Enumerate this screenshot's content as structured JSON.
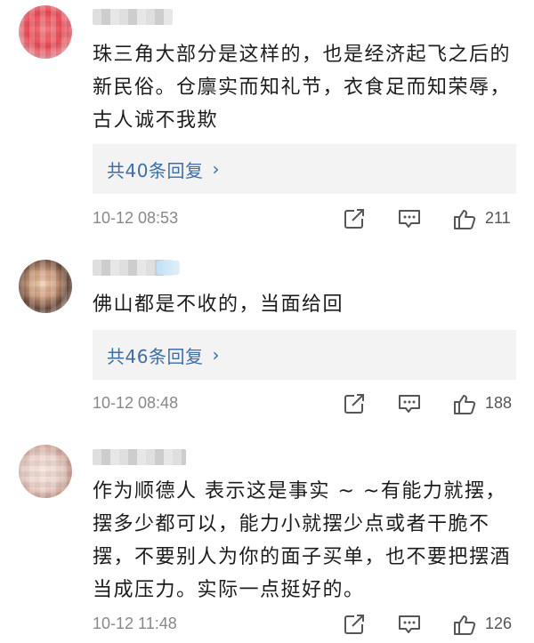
{
  "comments": [
    {
      "text": "珠三角大部分是这样的，也是经济起飞之后的新民俗。仓廪实而知礼节，衣食足而知荣辱，古人诚不我欺",
      "replies_label": "共40条回复",
      "time": "10-12 08:53",
      "likes": "211"
    },
    {
      "text": "佛山都是不收的，当面给回",
      "replies_label": "共46条回复",
      "time": "10-12 08:48",
      "likes": "188"
    },
    {
      "text": "作为顺德人 表示这是事实 ~ ~有能力就摆，摆多少都可以，能力小就摆少点或者干脆不摆，不要别人为你的面子买单，也不要把摆酒当成压力。实际一点挺好的。",
      "time": "10-12 11:48",
      "likes": "126"
    }
  ],
  "icons": {
    "share": "share-icon",
    "comment": "comment-icon",
    "like": "thumbs-up-icon",
    "reply_chevron": "chevron-right-icon"
  },
  "colors": {
    "link": "#3c6fa8",
    "reply_box": "#f3f3f3",
    "meta": "#888888"
  }
}
